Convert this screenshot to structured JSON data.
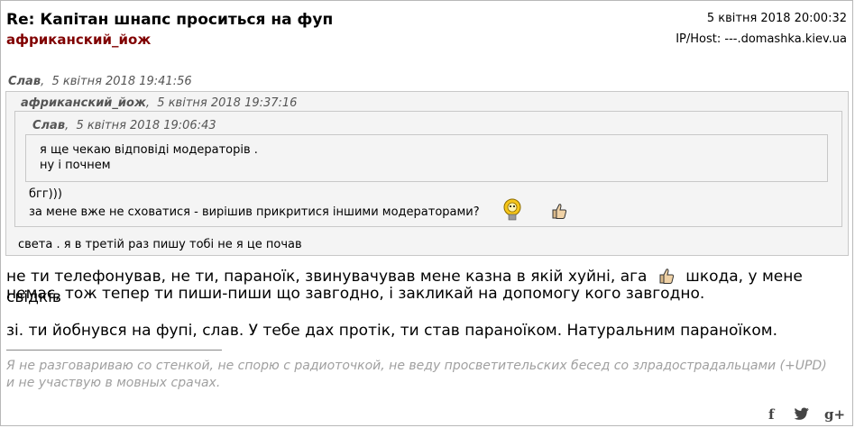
{
  "post": {
    "title": "Re: Капітан шнапс проситься на фуп",
    "author": "африканский_йож",
    "date": "5 квітня 2018 20:00:32",
    "iphost": "IP/Host: ---.domashka.kiev.ua"
  },
  "quotes": {
    "level1": {
      "name": "Слав",
      "date": "5 квітня 2018 19:41:56",
      "text": "света . я в третій раз пишу тобі не я це почав"
    },
    "level2": {
      "name": "африканский_йож",
      "date": "5 квітня 2018 19:37:16",
      "line1": "бгг)))",
      "line2": "за мене вже не сховатися - вирішив прикритися іншими модераторами?"
    },
    "level3": {
      "name": "Слав",
      "date": "5 квітня 2018 19:06:43",
      "line1": "я ще чекаю відповіді модераторів .",
      "line2": "ну і почнем"
    }
  },
  "body": {
    "line1a": "не ти телефонував, не ти, параноїк, звинувачував мене казна в якій хуйні, ага",
    "line1b": "шкода, у мене свідків",
    "line2": "немає, тож тепер ти пиши-пиши що завгодно, і закликай на допомогу кого завгодно.",
    "line3": "зі. ти йобнувся на фупі, слав. У тебе дах протік, ти став параноїком. Натуральним параноїком."
  },
  "signature": {
    "line1": "Я не разговариваю со стенкой, не спорю с радиоточкой, не веду просветительских бесед со злрадострадальцами  (+UPD)",
    "line2": "и не участвую в мовных срачах."
  },
  "social": {
    "facebook": "f",
    "twitter": "twitter-bird",
    "gplus": "g+"
  },
  "icons": [
    "lightbulb-smiley-icon",
    "thumbs-up-icon",
    "thumbs-up-icon"
  ]
}
